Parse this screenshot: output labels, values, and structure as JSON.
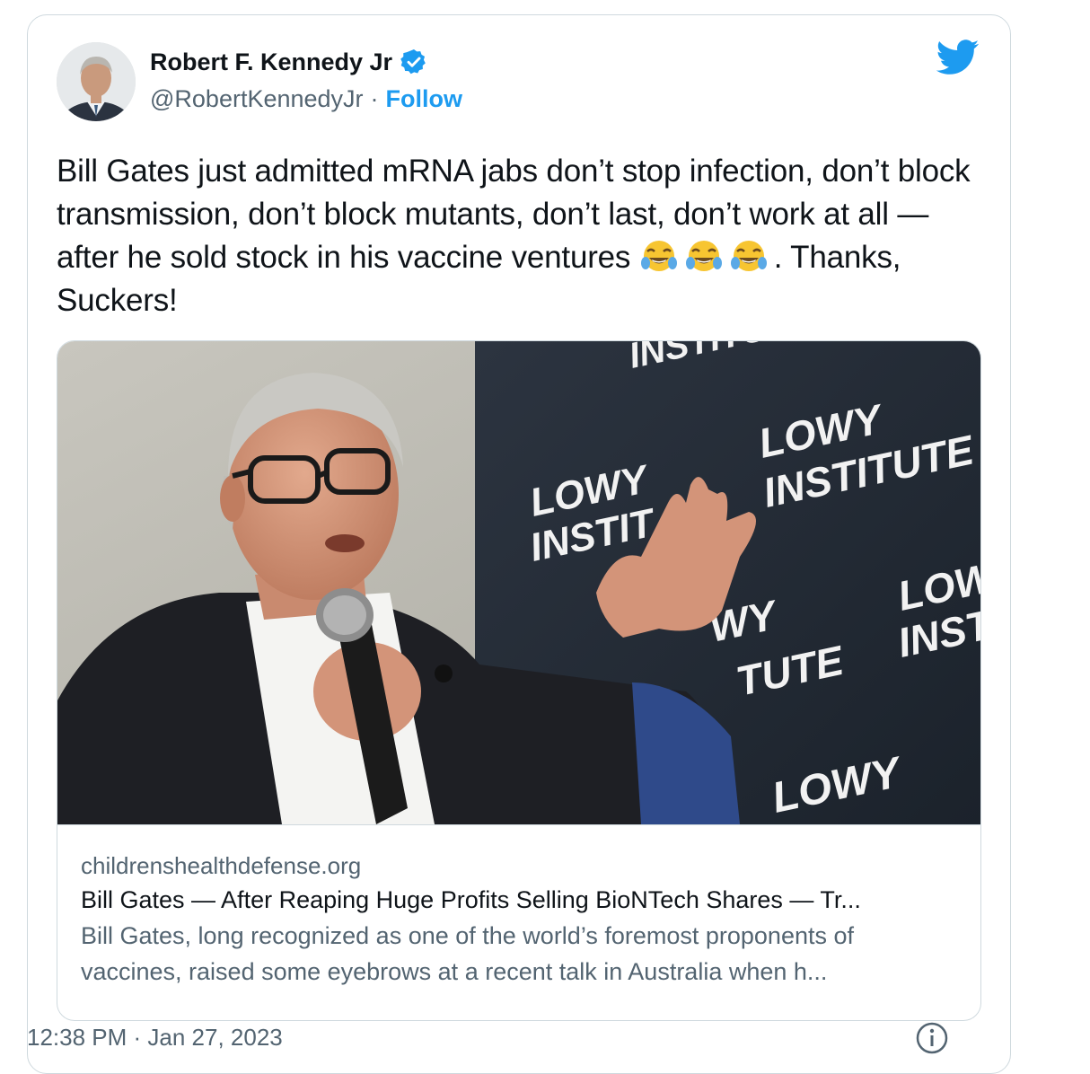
{
  "author": {
    "name": "Robert F. Kennedy Jr",
    "handle": "@RobertKennedyJr",
    "separator": "·",
    "follow_label": "Follow",
    "verified_color": "#1d9bf0"
  },
  "tweet": {
    "text_part1": "Bill Gates just admitted mRNA jabs don’t stop infection, don’t block transmission, don’t block mutants, don’t last, don’t work at all — after he sold stock in his vaccine ventures ",
    "emojis": [
      "face-with-tears-of-joy",
      "face-with-tears-of-joy",
      "face-with-tears-of-joy"
    ],
    "text_part2": ". Thanks, Suckers!"
  },
  "link_card": {
    "photo_signage": [
      "LOWY",
      "INSTITUTE",
      "INSTIT",
      "LOWY",
      "INSTITUTE",
      "LOW",
      "INST",
      "WY",
      "TUTE",
      "LOWY"
    ],
    "domain": "childrenshealthdefense.org",
    "title": "Bill Gates — After Reaping Huge Profits Selling BioNTech Shares — Tr...",
    "description": "Bill Gates, long recognized as one of the world’s foremost proponents of vaccines, raised some eyebrows at a recent talk in Australia when h..."
  },
  "timestamp": "12:38 PM · Jan 27, 2023",
  "colors": {
    "twitter_blue": "#1d9bf0",
    "border": "#cfd9de",
    "secondary_text": "#536471"
  },
  "icons": [
    "twitter-bird-icon",
    "verified-badge-icon",
    "info-icon"
  ]
}
